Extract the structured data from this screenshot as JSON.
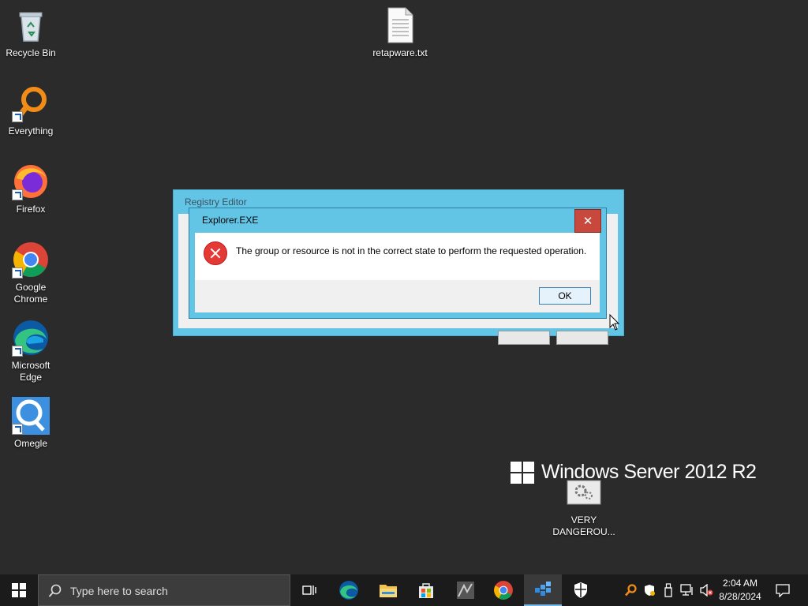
{
  "desktop": {
    "icons": [
      {
        "label": "Recycle Bin",
        "icon": "recycle-bin-icon"
      },
      {
        "label": "Everything",
        "icon": "everything-search-icon"
      },
      {
        "label": "Firefox",
        "icon": "firefox-icon"
      },
      {
        "label": "Google Chrome",
        "icon": "chrome-icon"
      },
      {
        "label": "Microsoft Edge",
        "icon": "edge-icon"
      },
      {
        "label": "Omegle",
        "icon": "omegle-icon"
      },
      {
        "label": "retapware.txt",
        "icon": "text-file-icon"
      },
      {
        "label": "VERY DANGEROU...",
        "icon": "settings-file-icon"
      }
    ],
    "branding": "Windows Server 2012 R2"
  },
  "background_window": {
    "title": "Registry Editor"
  },
  "dialog": {
    "title": "Explorer.EXE",
    "close_label": "✕",
    "message": "The group or resource is not in the correct state to perform the requested operation.",
    "ok_label": "OK"
  },
  "taskbar": {
    "search_placeholder": "Type here to search",
    "pinned": [
      "task-view-icon",
      "edge-icon",
      "file-explorer-icon",
      "store-icon",
      "app-icon",
      "chrome-icon",
      "regedit-icon",
      "security-icon"
    ],
    "tray": [
      "everything-icon",
      "defender-icon",
      "usb-icon",
      "network-icon",
      "volume-muted-icon"
    ],
    "time": "2:04 AM",
    "date": "8/28/2024"
  },
  "colors": {
    "desktop": "#2b2b2b",
    "dialog_frame": "#63c5e6",
    "close_button": "#c9483d",
    "taskbar": "#1b1b1b"
  }
}
